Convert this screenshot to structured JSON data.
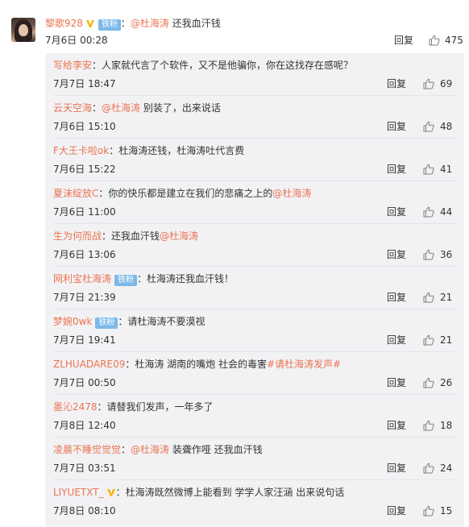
{
  "top_comment": {
    "username": "黎歌928",
    "fan_badge": "铁粉",
    "mention": "@杜海涛",
    "text": " 还我血汗钱",
    "time": "7月6日 00:28",
    "reply_label": "回复",
    "likes": "475"
  },
  "replies": [
    {
      "username": "写给李安",
      "badge": "",
      "segments": [
        {
          "t": "：人家就代言了个软件，又不是他骗你，你在这找存在感呢？",
          "m": false
        }
      ],
      "time": "7月7日 18:47",
      "reply_label": "回复",
      "likes": "69"
    },
    {
      "username": "云天空海",
      "badge": "",
      "segments": [
        {
          "t": "：",
          "m": false
        },
        {
          "t": "@杜海涛",
          "m": true
        },
        {
          "t": " 别装了，出来说话",
          "m": false
        }
      ],
      "time": "7月6日 15:10",
      "reply_label": "回复",
      "likes": "48"
    },
    {
      "username": "F大王卡啦ok",
      "badge": "",
      "segments": [
        {
          "t": "：杜海涛还钱，杜海涛吐代言费",
          "m": false
        }
      ],
      "time": "7月6日 15:22",
      "reply_label": "回复",
      "likes": "41"
    },
    {
      "username": "夏沫绽放C",
      "badge": "",
      "segments": [
        {
          "t": "：你的快乐都是建立在我们的悲痛之上的",
          "m": false
        },
        {
          "t": "@杜海涛",
          "m": true
        }
      ],
      "time": "7月6日 11:00",
      "reply_label": "回复",
      "likes": "44"
    },
    {
      "username": "生为何而战",
      "badge": "",
      "segments": [
        {
          "t": "：还我血汗钱",
          "m": false
        },
        {
          "t": "@杜海涛",
          "m": true
        }
      ],
      "time": "7月6日 13:06",
      "reply_label": "回复",
      "likes": "36"
    },
    {
      "username": "网利宝杜海涛",
      "badge": "铁粉",
      "segments": [
        {
          "t": "：杜海涛还我血汗钱！",
          "m": false
        }
      ],
      "time": "7月7日 21:39",
      "reply_label": "回复",
      "likes": "21"
    },
    {
      "username": "梦婉0wk",
      "badge": "铁粉",
      "segments": [
        {
          "t": "：请杜海涛不要漠视",
          "m": false
        }
      ],
      "time": "7月7日 19:41",
      "reply_label": "回复",
      "likes": "21"
    },
    {
      "username": "ZLHUADARE09",
      "badge": "",
      "segments": [
        {
          "t": "：杜海涛 湖南的嘴炮 社会的毒害",
          "m": false
        },
        {
          "t": "#请杜海涛发声#",
          "m": true
        }
      ],
      "time": "7月7日 00:50",
      "reply_label": "回复",
      "likes": "26"
    },
    {
      "username": "墨沁2478",
      "badge": "",
      "segments": [
        {
          "t": "：请替我们发声，一年多了",
          "m": false
        }
      ],
      "time": "7月8日 12:40",
      "reply_label": "回复",
      "likes": "18"
    },
    {
      "username": "凌晨不睡觉觉觉",
      "badge": "",
      "segments": [
        {
          "t": "：",
          "m": false
        },
        {
          "t": "@杜海涛",
          "m": true
        },
        {
          "t": " 装聋作哑   还我血汗钱",
          "m": false
        }
      ],
      "time": "7月7日 03:51",
      "reply_label": "回复",
      "likes": "24"
    },
    {
      "username": "LIYUETXT_",
      "badge": "v",
      "segments": [
        {
          "t": "：杜海涛既然微博上能看到 学学人家汪涵 出来说句话",
          "m": false
        }
      ],
      "time": "7月8日 08:10",
      "reply_label": "回复",
      "likes": "15"
    }
  ],
  "colors": {
    "username": "#eb7350",
    "text": "#333333",
    "panel_bg": "#f2f2f5",
    "fan_badge": "#7db9e8",
    "v_badge": "#f5b700"
  },
  "icons": {
    "like": "thumbs-up-icon",
    "verified": "v-verified-icon"
  }
}
